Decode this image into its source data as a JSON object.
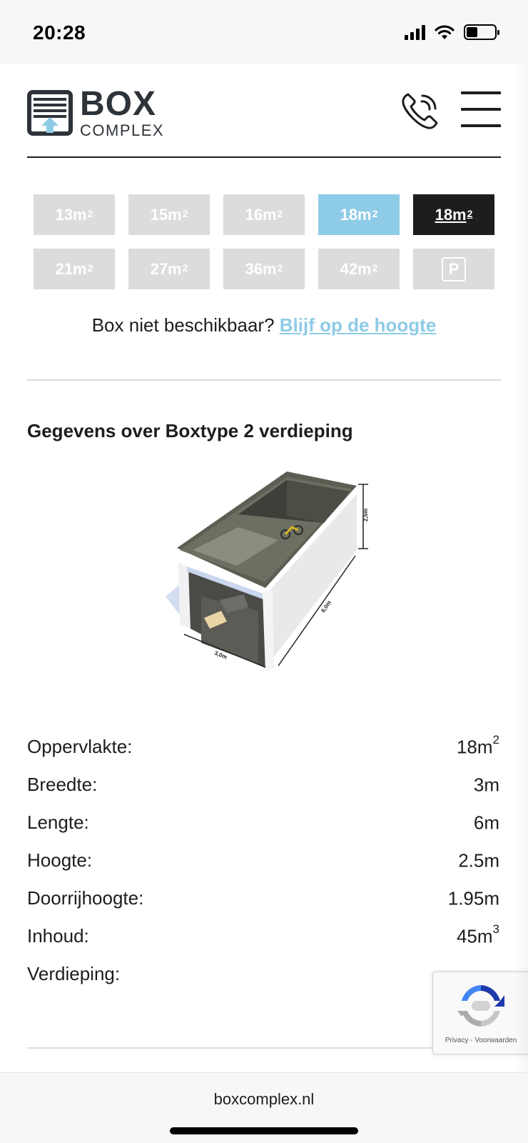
{
  "status_bar": {
    "time": "20:28",
    "icons": [
      "signal-icon",
      "wifi-icon",
      "battery-icon"
    ],
    "battery_level": 0.4
  },
  "header": {
    "logo_box": "BOX",
    "logo_complex": "COMPLEX",
    "icons": [
      "logo-icon",
      "phone-icon",
      "menu-icon"
    ]
  },
  "sizes": [
    {
      "num": "13m",
      "sup": "2",
      "state": "inactive"
    },
    {
      "num": "15m",
      "sup": "2",
      "state": "inactive"
    },
    {
      "num": "16m",
      "sup": "2",
      "state": "inactive"
    },
    {
      "num": "18m",
      "sup": "2",
      "state": "light-active"
    },
    {
      "num": "18m",
      "sup": "2",
      "state": "dark-active"
    },
    {
      "num": "21m",
      "sup": "2",
      "state": "inactive"
    },
    {
      "num": "27m",
      "sup": "2",
      "state": "inactive"
    },
    {
      "num": "36m",
      "sup": "2",
      "state": "inactive"
    },
    {
      "num": "42m",
      "sup": "2",
      "state": "inactive"
    },
    {
      "num": "P",
      "sup": "",
      "state": "parking"
    }
  ],
  "notice": {
    "text": "Box niet beschikbaar?",
    "link": "Blijf op de hoogte"
  },
  "section": {
    "title": "Gegevens over Boxtype 2 verdieping",
    "illustration_labels": {
      "height": "2,5m",
      "length": "6,0m",
      "width": "3,0m"
    }
  },
  "specs": [
    {
      "label": "Oppervlakte:",
      "value": "18m",
      "sup": "2"
    },
    {
      "label": "Breedte:",
      "value": "3m",
      "sup": ""
    },
    {
      "label": "Lengte:",
      "value": "6m",
      "sup": ""
    },
    {
      "label": "Hoogte:",
      "value": "2.5m",
      "sup": ""
    },
    {
      "label": "Doorrijhoogte:",
      "value": "1.95m",
      "sup": ""
    },
    {
      "label": "Inhoud:",
      "value": "45m",
      "sup": "3"
    },
    {
      "label": "Verdieping:",
      "value": "",
      "sup": ""
    }
  ],
  "recaptcha": {
    "links": "Privacy - Voorwaarden"
  },
  "browser": {
    "url": "boxcomplex.nl"
  },
  "colors": {
    "accent": "#8ecbe6",
    "dark": "#1d1d1f",
    "inactive": "#dcdcdc"
  }
}
